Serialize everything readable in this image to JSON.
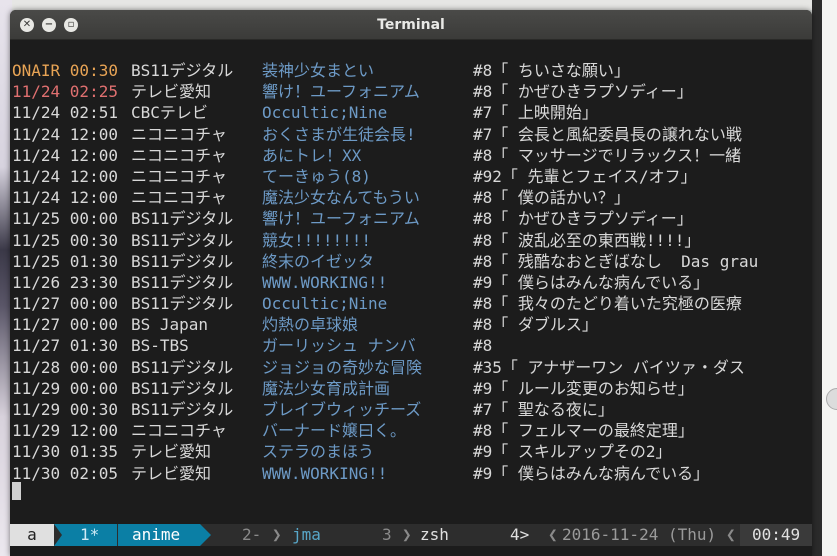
{
  "window": {
    "title": "Terminal"
  },
  "rows": [
    {
      "date": "ONAIR 00:30",
      "channel": "BS11デジタル",
      "title": "装神少女まとい",
      "episode": "#8「 ちいさな願い」",
      "state": "onair"
    },
    {
      "date": "11/24 02:25",
      "channel": "テレビ愛知",
      "title": "響け！ユーフォニアム",
      "episode": "#8「 かぜひきラプソディー」",
      "state": "soon"
    },
    {
      "date": "11/24 02:51",
      "channel": "CBCテレビ",
      "title": "Occultic;Nine",
      "episode": "#7「 上映開始」",
      "state": "normal"
    },
    {
      "date": "11/24 12:00",
      "channel": "ニコニコチャ",
      "title": "おくさまが生徒会長!",
      "episode": "#7「 会長と風紀委員長の譲れない戦",
      "state": "normal"
    },
    {
      "date": "11/24 12:00",
      "channel": "ニコニコチャ",
      "title": "あにトレ！XX",
      "episode": "#8「 マッサージでリラックス！一緒",
      "state": "normal"
    },
    {
      "date": "11/24 12:00",
      "channel": "ニコニコチャ",
      "title": "てーきゅう(8)",
      "episode": "#92「 先輩とフェイス/オフ」",
      "state": "normal"
    },
    {
      "date": "11/24 12:00",
      "channel": "ニコニコチャ",
      "title": "魔法少女なんてもうい",
      "episode": "#8「 僕の話かい？」",
      "state": "normal"
    },
    {
      "date": "11/25 00:00",
      "channel": "BS11デジタル",
      "title": "響け！ユーフォニアム",
      "episode": "#8「 かぜひきラプソディー」",
      "state": "normal"
    },
    {
      "date": "11/25 00:30",
      "channel": "BS11デジタル",
      "title": "競女!!!!!!!!",
      "episode": "#8「 波乱必至の東西戦!!!!」",
      "state": "normal"
    },
    {
      "date": "11/25 01:30",
      "channel": "BS11デジタル",
      "title": "終末のイゼッタ",
      "episode": "#8「 残酷なおとぎばなし  Das grau",
      "state": "normal"
    },
    {
      "date": "11/26 23:30",
      "channel": "BS11デジタル",
      "title": "WWW.WORKING!!",
      "episode": "#9「 僕らはみんな病んでいる」",
      "state": "normal"
    },
    {
      "date": "11/27 00:00",
      "channel": "BS11デジタル",
      "title": "Occultic;Nine",
      "episode": "#8「 我々のたどり着いた究極の医療",
      "state": "normal"
    },
    {
      "date": "11/27 00:00",
      "channel": "BS Japan",
      "title": "灼熱の卓球娘",
      "episode": "#8「 ダブルス」",
      "state": "normal"
    },
    {
      "date": "11/27 01:30",
      "channel": "BS-TBS",
      "title": "ガーリッシュ ナンバ",
      "episode": "#8",
      "state": "normal"
    },
    {
      "date": "11/28 00:00",
      "channel": "BS11デジタル",
      "title": "ジョジョの奇妙な冒険",
      "episode": "#35「 アナザーワン バイツァ・ダス",
      "state": "normal"
    },
    {
      "date": "11/29 00:00",
      "channel": "BS11デジタル",
      "title": "魔法少女育成計画",
      "episode": "#9「 ルール変更のお知らせ」",
      "state": "normal"
    },
    {
      "date": "11/29 00:30",
      "channel": "BS11デジタル",
      "title": "ブレイブウィッチーズ",
      "episode": "#7「 聖なる夜に」",
      "state": "normal"
    },
    {
      "date": "11/29 12:00",
      "channel": "ニコニコチャ",
      "title": "バーナード嬢曰く。",
      "episode": "#8「 フェルマーの最終定理」",
      "state": "normal"
    },
    {
      "date": "11/30 01:35",
      "channel": "テレビ愛知",
      "title": "ステラのまほう",
      "episode": "#9「 スキルアップその2」",
      "state": "normal"
    },
    {
      "date": "11/30 02:05",
      "channel": "テレビ愛知",
      "title": "WWW.WORKING!!",
      "episode": "#9「 僕らはみんな病んでいる」",
      "state": "normal"
    }
  ],
  "statusbar": {
    "session": "a",
    "win1_index": "1*",
    "win1_name": "anime",
    "win2_index": "2-",
    "win2_name": "jma",
    "win3_index": "3",
    "win3_name": "zsh",
    "win4_index": "4>",
    "date": "2016-11-24 (Thu)",
    "time": "00:49"
  },
  "colors": {
    "onair": "#e8a455",
    "soon": "#e07070",
    "title": "#6d9ac6",
    "active_window": "#0b7fa5"
  }
}
